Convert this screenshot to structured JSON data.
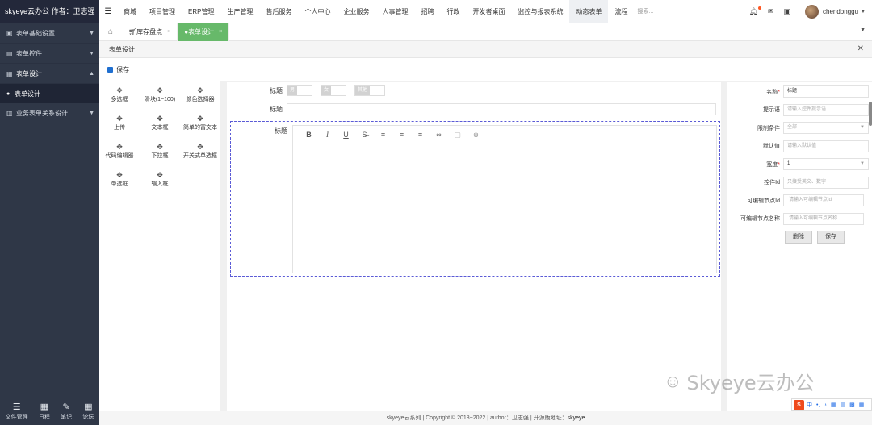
{
  "brand": "skyeye云办公 作者：卫志强",
  "sidebar": {
    "items": [
      {
        "icon": "▣",
        "label": "表单基础设置",
        "caret": "▼"
      },
      {
        "icon": "▤",
        "label": "表单控件",
        "caret": "▼"
      },
      {
        "icon": "▦",
        "label": "表单设计",
        "caret": "▲"
      },
      {
        "icon": "▥",
        "label": "业务表单关系设计",
        "caret": "▼"
      }
    ],
    "sub_items": [
      {
        "icon": "●",
        "label": "表单设计"
      }
    ],
    "tools": [
      {
        "icon": "☰",
        "label": "文件管理"
      },
      {
        "icon": "▦",
        "label": "日程"
      },
      {
        "icon": "✎",
        "label": "笔记"
      },
      {
        "icon": "▦",
        "label": "论坛"
      }
    ]
  },
  "topnav": {
    "menu_icon": "☰",
    "items": [
      "商城",
      "项目管理",
      "ERP管理",
      "生产管理",
      "售后服务",
      "个人中心",
      "企业服务",
      "人事管理",
      "招聘",
      "行政",
      "开发者桌面",
      "监控与报表系统",
      "动态表单",
      "流程"
    ],
    "active_index": 12,
    "search_placeholder": "搜索...",
    "icons": {
      "bell": "🔔︎",
      "mail": "✉",
      "window": "▣"
    },
    "username": "chendonggu",
    "caret": "▼"
  },
  "tabbar": {
    "home_icon": "⌂",
    "tabs": [
      {
        "icon": "🛒︎",
        "label": "库存盘点",
        "close": "×"
      },
      {
        "icon": "●",
        "label": "表单设计",
        "close": "×"
      }
    ],
    "more": "▼"
  },
  "page": {
    "title": "表单设计",
    "close": "✕",
    "save_label": "保存"
  },
  "palette": {
    "move_icon": "✥",
    "items": [
      "多选框",
      "滑块(1~100)",
      "颜色选择器",
      "上传",
      "文本框",
      "简单的富文本",
      "代码编辑器",
      "下拉框",
      "开关式单选框",
      "单选框",
      "输入框"
    ]
  },
  "canvas": {
    "radio_row": {
      "label": "标题",
      "options": [
        "男",
        "女",
        "其他"
      ]
    },
    "text_row": {
      "label": "标题"
    },
    "rich_row": {
      "label": "标题"
    },
    "editor_toolbar": [
      "B",
      "I",
      "U",
      "S̶",
      "≡",
      "≡",
      "≡",
      "∞",
      "▢",
      "☺"
    ]
  },
  "props": {
    "rows": [
      {
        "label": "名称",
        "required": true,
        "value": "标题",
        "filled": true,
        "select": false
      },
      {
        "label": "提示语",
        "required": false,
        "value": "请输入控件提示语",
        "filled": false,
        "select": false
      },
      {
        "label": "限制条件",
        "required": false,
        "value": "全部",
        "filled": false,
        "select": true
      },
      {
        "label": "默认值",
        "required": false,
        "value": "请输入默认值",
        "filled": false,
        "select": false
      },
      {
        "label": "宽度",
        "required": true,
        "value": "1",
        "filled": true,
        "select": true
      },
      {
        "label": "控件Id",
        "required": false,
        "value": "只接受英文、数字",
        "filled": false,
        "select": false
      },
      {
        "label": "可编辑节点Id",
        "required": false,
        "value": "请输入可编辑节点Id",
        "filled": false,
        "select": false
      },
      {
        "label": "可编辑节点名称",
        "required": false,
        "value": "请输入可编辑节点名称",
        "filled": false,
        "select": false
      }
    ],
    "required_mark": "*",
    "delete_label": "删除",
    "save_label": "保存"
  },
  "footer": {
    "text": "skyeye云系列 | Copyright © 2018~2022 | author：卫志强 | 开源版地址：",
    "link": "skyeye"
  },
  "watermark": {
    "text": "Skyeye云办公"
  },
  "ime": {
    "logo": "S",
    "items": [
      "中",
      "•,",
      "♪",
      "▦",
      "▤",
      "▩",
      "▦"
    ]
  }
}
